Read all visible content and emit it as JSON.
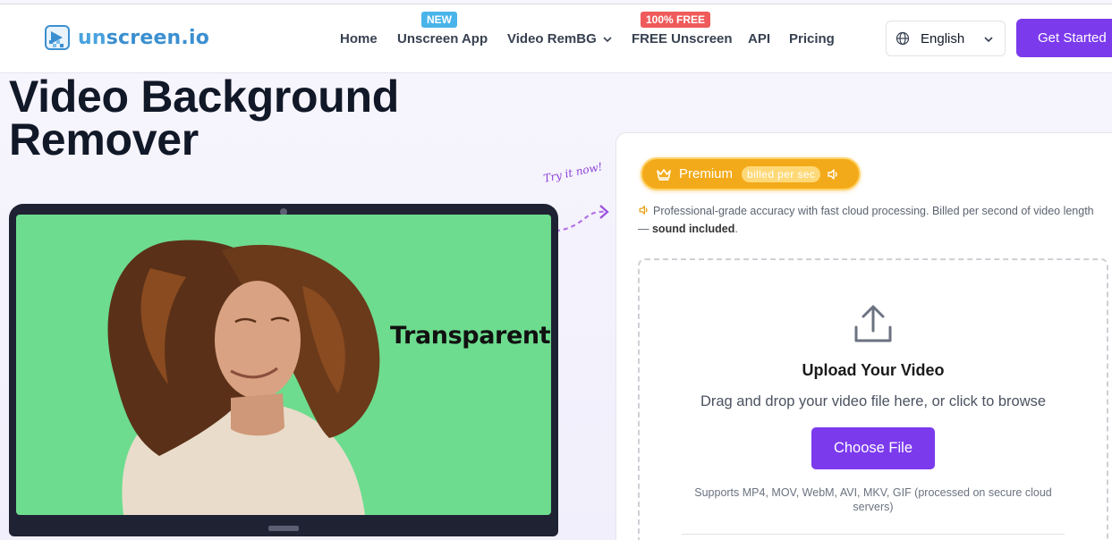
{
  "header": {
    "logo": {
      "part1": "un",
      "part2": "screen.io"
    },
    "nav": [
      {
        "label": "Home"
      },
      {
        "label": "Unscreen App",
        "badge": "NEW"
      },
      {
        "label": "Video RemBG"
      },
      {
        "label": "FREE Unscreen",
        "badge": "100% FREE"
      },
      {
        "label": "API"
      },
      {
        "label": "Pricing"
      }
    ],
    "language": "English",
    "cta": "Get Started"
  },
  "hero": {
    "title_line1": "Video Background",
    "title_line2": "Remover",
    "try_it": "Try it now!",
    "screen_label": "Transparent"
  },
  "panel": {
    "premium_label": "Premium",
    "premium_billing": "billed per sec",
    "description": "Professional-grade accuracy with fast cloud processing. Billed per second of video length — ",
    "description_bold": "sound included",
    "description_end": ".",
    "upload_title": "Upload Your Video",
    "upload_subtitle": "Drag and drop your video file here, or click to browse",
    "choose_button": "Choose File",
    "supports": "Supports MP4, MOV, WebM, AVI, MKV, GIF (processed on secure cloud servers)"
  },
  "colors": {
    "accent": "#7c3aed",
    "premium": "#f3aa1a",
    "screen_bg": "#6ddc8e",
    "badge_new": "#49b4ea",
    "badge_free": "#ef5a5a"
  },
  "icons": [
    "logo-icon",
    "chevron-down-icon",
    "globe-icon",
    "crown-icon",
    "speaker-icon",
    "upload-icon",
    "curved-arrow-icon"
  ]
}
